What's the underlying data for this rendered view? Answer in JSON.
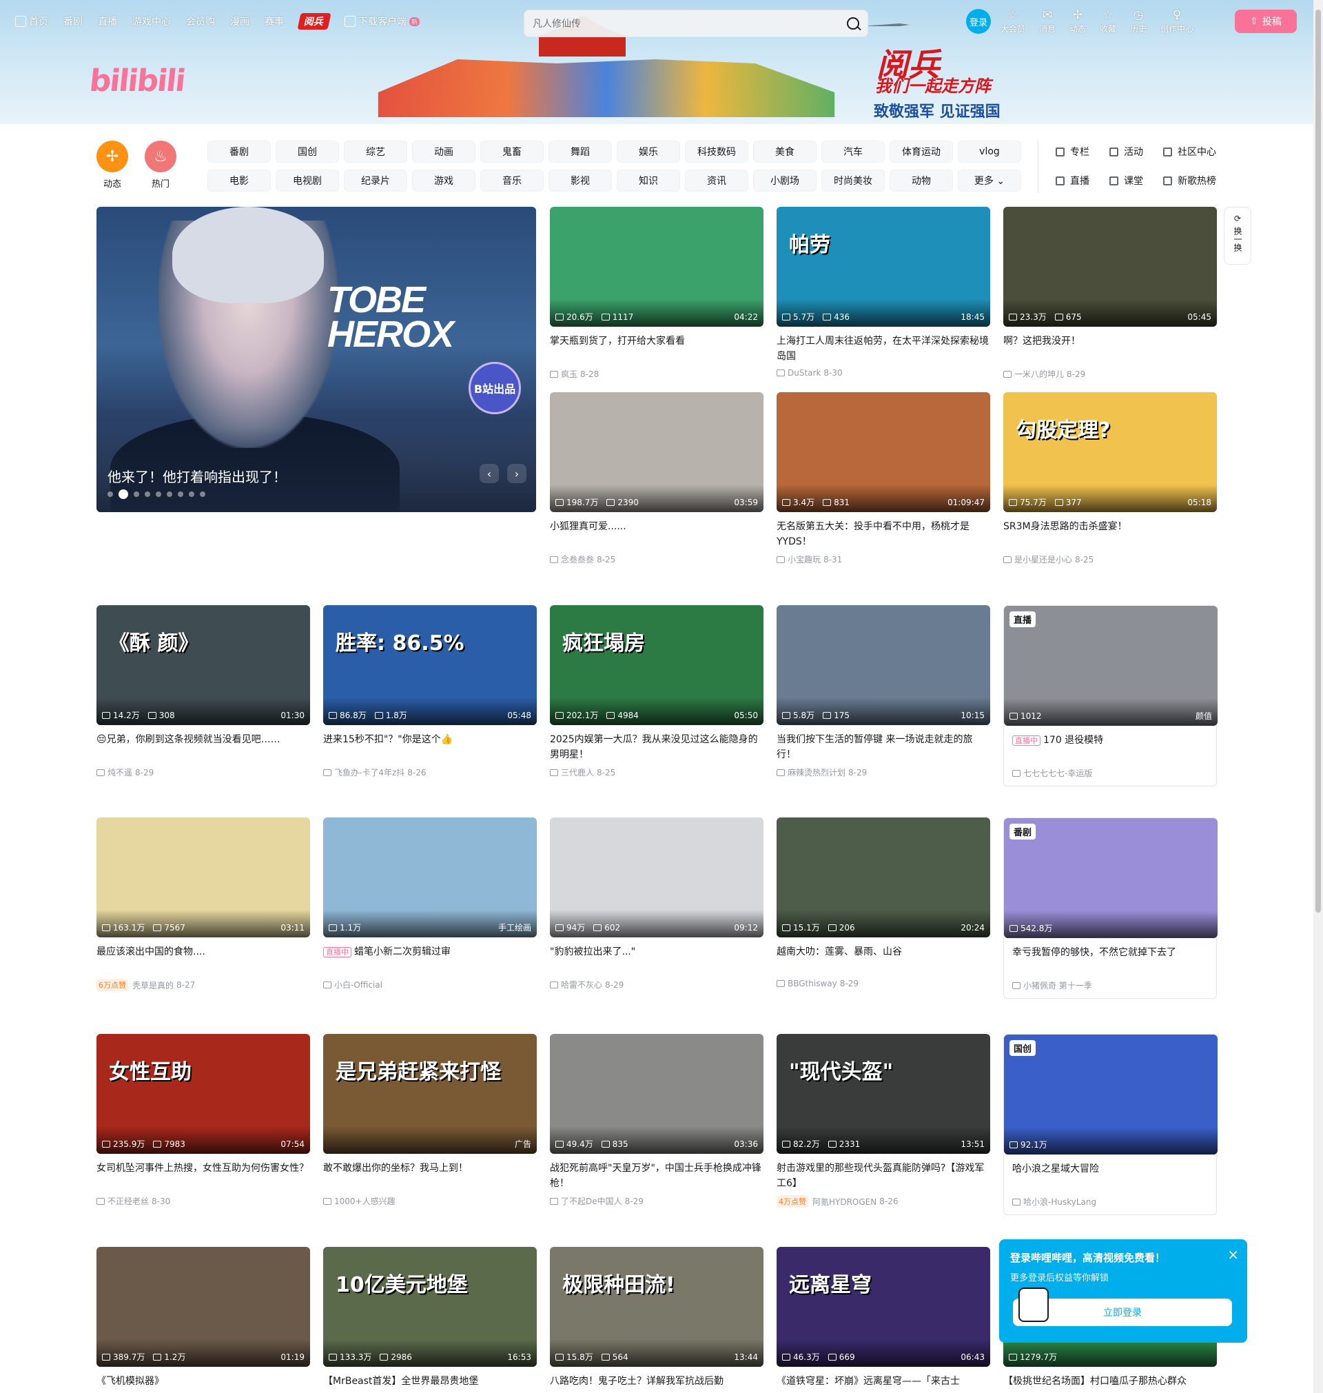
{
  "nav": {
    "items": [
      "首页",
      "番剧",
      "直播",
      "游戏中心",
      "会员购",
      "漫画",
      "赛事"
    ],
    "badge": "阅兵",
    "download": "下载客户端",
    "new_tag": "新"
  },
  "search": {
    "placeholder": "凡人修仙传"
  },
  "right_nav": {
    "login": "登录",
    "items": [
      "大会员",
      "消息",
      "动态",
      "收藏",
      "历史",
      "创作中心"
    ],
    "upload": "投稿"
  },
  "banner": {
    "logo": "bilibili",
    "slogan_main": "阅兵",
    "slogan_sub1": "我们一起走方阵",
    "slogan_sub2": "致敬强军 见证强国"
  },
  "quick": {
    "dynamic": "动态",
    "hot": "热门"
  },
  "channels": {
    "row1": [
      "番剧",
      "国创",
      "综艺",
      "动画",
      "鬼畜",
      "舞蹈",
      "娱乐",
      "科技数码",
      "美食",
      "汽车",
      "体育运动",
      "vlog"
    ],
    "row2": [
      "电影",
      "电视剧",
      "纪录片",
      "游戏",
      "音乐",
      "影视",
      "知识",
      "资讯",
      "小剧场",
      "时尚美妆",
      "动物",
      "更多"
    ]
  },
  "side_links": {
    "row1": [
      "专栏",
      "活动",
      "社区中心"
    ],
    "row2": [
      "直播",
      "课堂",
      "新歌热榜"
    ]
  },
  "carousel": {
    "caption": "他来了！他打着响指出现了！",
    "art_title": "TOBE HEROX",
    "badge": "B站出品",
    "prev": "‹",
    "next": "›"
  },
  "swap": "换一换",
  "cards": [
    {
      "views": "20.6万",
      "danmaku": "1117",
      "dur": "04:22",
      "title": "掌天瓶到货了，打开给大家看看",
      "up": "疯玉",
      "date": "8-28",
      "bg": "#3aa26a",
      "art": ""
    },
    {
      "views": "5.7万",
      "danmaku": "436",
      "dur": "18:45",
      "title": "上海打工人周末往返帕劳，在太平洋深处探索秘境岛国",
      "up": "DuStark",
      "date": "8-30",
      "bg": "#1e8fb8",
      "art": "帕劳"
    },
    {
      "views": "23.3万",
      "danmaku": "675",
      "dur": "05:45",
      "title": "啊？这把我没开！",
      "up": "一米八的坤儿",
      "date": "8-29",
      "bg": "#4a4e3a",
      "art": ""
    },
    {
      "views": "198.7万",
      "danmaku": "2390",
      "dur": "03:59",
      "title": "小狐狸真可爱......",
      "up": "念叁叁叁",
      "date": "8-25",
      "bg": "#b7b3ac",
      "art": ""
    },
    {
      "views": "3.4万",
      "danmaku": "831",
      "dur": "01:09:47",
      "title": "无名版第五大关：投手中看不中用，杨桃才是YYDS！",
      "up": "小宝趣玩",
      "date": "8-31",
      "bg": "#b8683a",
      "art": ""
    },
    {
      "views": "75.7万",
      "danmaku": "377",
      "dur": "05:18",
      "title": "SR3M身法思路的击杀盛宴！",
      "up": "是小星还是小心",
      "date": "8-25",
      "bg": "#f2c24e",
      "art": "勾股定理?"
    },
    {
      "views": "14.2万",
      "danmaku": "308",
      "dur": "01:30",
      "title": "😔兄弟，你刷到这条视频就当没看见吧……",
      "up": "炖不遥",
      "date": "8-29",
      "bg": "#3f4c52",
      "art": "《酥 颜》"
    },
    {
      "views": "86.8万",
      "danmaku": "1.8万",
      "dur": "05:48",
      "title": "进来15秒不扣\"？\"你是这个👍",
      "up": "飞鱼办-卡了4年z抖",
      "date": "8-26",
      "bg": "#2a5ea8",
      "art": "胜率: 86.5%"
    },
    {
      "views": "202.1万",
      "danmaku": "4984",
      "dur": "05:50",
      "title": "2025内娱第一大瓜？我从来没见过这么能隐身的男明星！",
      "up": "三代鹿人",
      "date": "8-25",
      "bg": "#2c7a44",
      "art": "疯狂塌房"
    },
    {
      "views": "5.8万",
      "danmaku": "175",
      "dur": "10:15",
      "title": "当我们按下生活的暂停键 来一场说走就走的旅行！",
      "up": "麻辣烫热烈计划",
      "date": "8-29",
      "bg": "#6a7c92",
      "art": ""
    },
    {
      "views": "1012",
      "danmaku": "",
      "dur": "颜值",
      "title": "170 退役模特",
      "up": "七七七七七-幸运版",
      "date": "",
      "bg": "#8d8f96",
      "art": "",
      "tag": "直播",
      "live": "直播中"
    },
    {
      "views": "163.1万",
      "danmaku": "7567",
      "dur": "03:11",
      "title": "最应该滚出中国的食物....",
      "up": "秃草是真的",
      "date": "8-27",
      "bg": "#e6d7a0",
      "art": "",
      "hot": "6万点赞"
    },
    {
      "views": "1.1万",
      "danmaku": "",
      "dur": "手工绘画",
      "title": "蜡笔小新二次剪辑过审",
      "up": "小白-Official",
      "date": "",
      "bg": "#8fb8d6",
      "art": "",
      "live": "直播中"
    },
    {
      "views": "94万",
      "danmaku": "602",
      "dur": "09:12",
      "title": "\"豹豹被拉出来了...\"",
      "up": "哈雷不灰心",
      "date": "8-29",
      "bg": "#d7d8dc",
      "art": ""
    },
    {
      "views": "15.1万",
      "danmaku": "206",
      "dur": "20:24",
      "title": "越南大叻：莲雾、暴雨、山谷",
      "up": "BBGthisway",
      "date": "8-29",
      "bg": "#4d5d4a",
      "art": ""
    },
    {
      "views": "542.8万",
      "danmaku": "",
      "dur": "",
      "title": "幸亏我暂停的够快，不然它就掉下去了",
      "up": "小猪佩奇 第十一季",
      "date": "",
      "bg": "#9a8ed8",
      "art": "",
      "tag": "番剧"
    },
    {
      "views": "235.9万",
      "danmaku": "7983",
      "dur": "07:54",
      "title": "女司机坠河事件上热搜，女性互助为何伤害女性？",
      "up": "不正经老丝",
      "date": "8-30",
      "bg": "#a8281c",
      "art": "女性互助"
    },
    {
      "views": "",
      "danmaku": "",
      "dur": "广告",
      "title": "敢不敢爆出你的坐标？我马上到！",
      "up": "1000+人感兴趣",
      "date": "",
      "bg": "#7a5a34",
      "art": "是兄弟赶紧来打怪"
    },
    {
      "views": "49.4万",
      "danmaku": "835",
      "dur": "03:36",
      "title": "战犯死前高呼\"天皇万岁\"，中国士兵手枪换成冲锋枪！",
      "up": "了不起De中国人",
      "date": "8-29",
      "bg": "#8a8a88",
      "art": ""
    },
    {
      "views": "82.2万",
      "danmaku": "2331",
      "dur": "13:51",
      "title": "射击游戏里的那些现代头盔真能防弹吗?【游戏军工6】",
      "up": "阿氪HYDROGEN",
      "date": "8-26",
      "bg": "#3a3c3c",
      "art": "\"现代头盔\"",
      "hot": "4万点赞"
    },
    {
      "views": "92.1万",
      "danmaku": "",
      "dur": "",
      "title": "哈小浪之星域大冒险",
      "up": "哈小浪-HuskyLang",
      "date": "",
      "bg": "#3a5fc8",
      "art": "",
      "tag": "国创"
    },
    {
      "views": "389.7万",
      "danmaku": "1.2万",
      "dur": "01:19",
      "title": "《飞机模拟器》",
      "up": "",
      "date": "",
      "bg": "#6b5a4a",
      "art": ""
    },
    {
      "views": "133.3万",
      "danmaku": "2986",
      "dur": "16:53",
      "title": "【MrBeast首发】全世界最昂贵地堡",
      "up": "",
      "date": "",
      "bg": "#5a6a4a",
      "art": "10亿美元地堡"
    },
    {
      "views": "15.8万",
      "danmaku": "564",
      "dur": "13:44",
      "title": "八路吃肉！鬼子吃土？详解我军抗战后勤",
      "up": "",
      "date": "",
      "bg": "#7a7868",
      "art": "极限种田流!"
    },
    {
      "views": "46.3万",
      "danmaku": "669",
      "dur": "06:43",
      "title": "《道铁穹星：坏崩》远离星穹——「来古士",
      "up": "",
      "date": "",
      "bg": "#3a2a6a",
      "art": "远离星穹"
    },
    {
      "views": "1279.7万",
      "danmaku": "",
      "dur": "",
      "title": "【极挑世纪名场面】村口嗑瓜子那热心群众",
      "up": "",
      "date": "",
      "bg": "#2a8a4a",
      "art": ""
    }
  ],
  "popup": {
    "heading": "登录哔哩哔哩，高清视频免费看！",
    "sub": "更多登录后权益等你解锁",
    "button": "立即登录",
    "close": "×"
  }
}
